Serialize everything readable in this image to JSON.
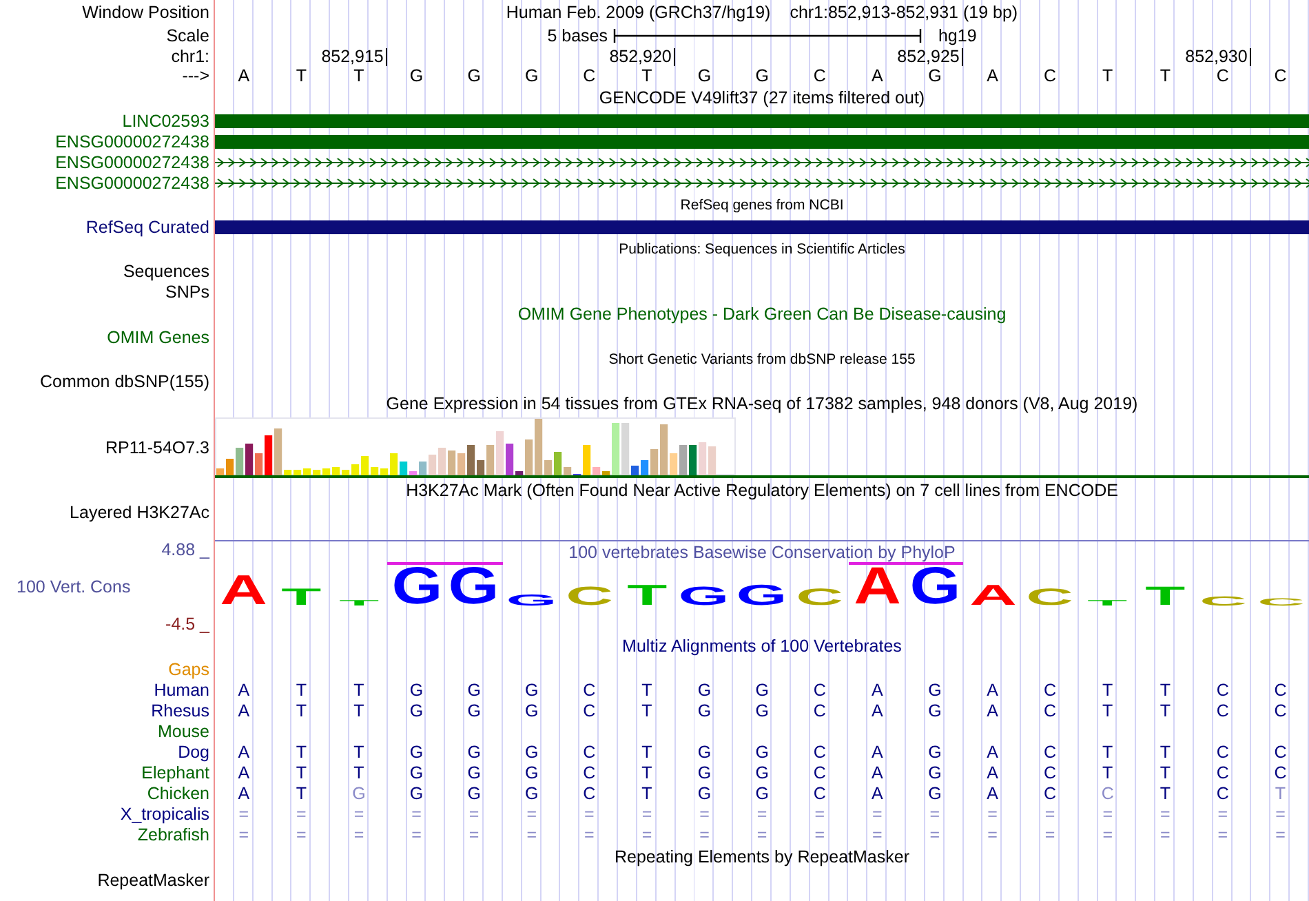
{
  "rows": [
    {
      "kind": "position",
      "label": "Window Position",
      "assembly": "Human Feb. 2009 (GRCh37/hg19)",
      "range": "chr1:852,913-852,931 (19 bp)"
    },
    {
      "kind": "scale",
      "label": "Scale",
      "span": "5 bases",
      "assembly": "hg19"
    },
    {
      "kind": "ruler",
      "label": "chr1:",
      "ticks": [
        "852,915",
        "852,920",
        "852,925",
        "852,930"
      ]
    },
    {
      "kind": "bases",
      "label": "--->",
      "bases": [
        "A",
        "T",
        "T",
        "G",
        "G",
        "G",
        "C",
        "T",
        "G",
        "G",
        "C",
        "A",
        "G",
        "A",
        "C",
        "T",
        "T",
        "C",
        "C"
      ]
    },
    {
      "kind": "title",
      "title": "GENCODE V49lift37 (27 items filtered out)"
    },
    {
      "kind": "bar",
      "label": "LINC02593",
      "color": "#006400"
    },
    {
      "kind": "bar",
      "label": "ENSG00000272438",
      "color": "#006400"
    },
    {
      "kind": "arrows",
      "label": "ENSG00000272438",
      "color": "#006400"
    },
    {
      "kind": "arrows",
      "label": "ENSG00000272438",
      "color": "#006400"
    },
    {
      "kind": "subtitle",
      "title": "RefSeq genes from NCBI"
    },
    {
      "kind": "bar",
      "label": "RefSeq Curated",
      "color": "#0c0c78"
    },
    {
      "kind": "subtitle",
      "title": "Publications: Sequences in Scientific Articles"
    },
    {
      "kind": "label",
      "label": "Sequences"
    },
    {
      "kind": "label",
      "label": "SNPs"
    },
    {
      "kind": "title",
      "title": "OMIM Gene Phenotypes - Dark Green Can Be Disease-causing",
      "color": "#006400"
    },
    {
      "kind": "label",
      "label": "OMIM Genes",
      "color": "#006400"
    },
    {
      "kind": "subtitle",
      "title": "Short Genetic Variants from dbSNP release 155"
    },
    {
      "kind": "label",
      "label": "Common dbSNP(155)"
    },
    {
      "kind": "title",
      "title": "Gene Expression in 54 tissues from GTEx RNA-seq of 17382 samples, 948 donors (V8, Aug 2019)"
    },
    {
      "kind": "expression",
      "label": "RP11-54O7.3"
    },
    {
      "kind": "title",
      "title": "H3K27Ac Mark (Often Found Near Active Regulatory Elements) on 7 cell lines from ENCODE"
    },
    {
      "kind": "layered",
      "label": "Layered H3K27Ac"
    },
    {
      "kind": "conservation",
      "label": "100 Vert. Cons",
      "max": "4.88 _",
      "min": "-4.5 _",
      "title": "100 vertebrates Basewise Conservation by PhyloP",
      "letters": [
        {
          "text": "A",
          "color": "#ff0000",
          "marked": false
        },
        {
          "text": "T",
          "color": "#00c000",
          "marked": false
        },
        {
          "text": "T",
          "color": "#00c000",
          "marked": false
        },
        {
          "text": "G",
          "color": "#0000ff",
          "marked": true
        },
        {
          "text": "G",
          "color": "#0000ff",
          "marked": true
        },
        {
          "text": "G",
          "color": "#0000ff",
          "marked": false
        },
        {
          "text": "C",
          "color": "#b0a800",
          "marked": false
        },
        {
          "text": "T",
          "color": "#00c000",
          "marked": false
        },
        {
          "text": "G",
          "color": "#0000ff",
          "marked": false
        },
        {
          "text": "G",
          "color": "#0000ff",
          "marked": false
        },
        {
          "text": "C",
          "color": "#b0a800",
          "marked": false
        },
        {
          "text": "A",
          "color": "#ff0000",
          "marked": true
        },
        {
          "text": "G",
          "color": "#0000ff",
          "marked": true
        },
        {
          "text": "A",
          "color": "#ff0000",
          "marked": false
        },
        {
          "text": "C",
          "color": "#b0a800",
          "marked": false
        },
        {
          "text": "T",
          "color": "#00c000",
          "marked": false
        },
        {
          "text": "T",
          "color": "#00c000",
          "marked": false
        },
        {
          "text": "C",
          "color": "#b0a800",
          "marked": false
        },
        {
          "text": "C",
          "color": "#b0a800",
          "marked": false
        }
      ]
    },
    {
      "kind": "title",
      "title": "Multiz Alignments of 100 Vertebrates",
      "color": "#000080"
    },
    {
      "kind": "species",
      "label": "Gaps",
      "color": "#e08c00"
    },
    {
      "kind": "species",
      "label": "Human",
      "color": "#000080",
      "bases": [
        "A",
        "T",
        "T",
        "G",
        "G",
        "G",
        "C",
        "T",
        "G",
        "G",
        "C",
        "A",
        "G",
        "A",
        "C",
        "T",
        "T",
        "C",
        "C"
      ],
      "faded": [
        false,
        false,
        false,
        false,
        false,
        false,
        false,
        false,
        false,
        false,
        false,
        false,
        false,
        false,
        false,
        false,
        false,
        false,
        false
      ]
    },
    {
      "kind": "species",
      "label": "Rhesus",
      "color": "#000080",
      "bases": [
        "A",
        "T",
        "T",
        "G",
        "G",
        "G",
        "C",
        "T",
        "G",
        "G",
        "C",
        "A",
        "G",
        "A",
        "C",
        "T",
        "T",
        "C",
        "C"
      ],
      "faded": [
        false,
        false,
        false,
        false,
        false,
        false,
        false,
        false,
        false,
        false,
        false,
        false,
        false,
        false,
        false,
        false,
        false,
        false,
        false
      ]
    },
    {
      "kind": "species",
      "label": "Mouse",
      "color": "#006400"
    },
    {
      "kind": "species",
      "label": "Dog",
      "color": "#000080",
      "bases": [
        "A",
        "T",
        "T",
        "G",
        "G",
        "G",
        "C",
        "T",
        "G",
        "G",
        "C",
        "A",
        "G",
        "A",
        "C",
        "T",
        "T",
        "C",
        "C"
      ],
      "faded": [
        false,
        false,
        false,
        false,
        false,
        false,
        false,
        false,
        false,
        false,
        false,
        false,
        false,
        false,
        false,
        false,
        false,
        false,
        false
      ]
    },
    {
      "kind": "species",
      "label": "Elephant",
      "color": "#006400",
      "bases": [
        "A",
        "T",
        "T",
        "G",
        "G",
        "G",
        "C",
        "T",
        "G",
        "G",
        "C",
        "A",
        "G",
        "A",
        "C",
        "T",
        "T",
        "C",
        "C"
      ],
      "faded": [
        false,
        false,
        false,
        false,
        false,
        false,
        false,
        false,
        false,
        false,
        false,
        false,
        false,
        false,
        false,
        false,
        false,
        false,
        false
      ]
    },
    {
      "kind": "species",
      "label": "Chicken",
      "color": "#006400",
      "bases": [
        "A",
        "T",
        "G",
        "G",
        "G",
        "G",
        "C",
        "T",
        "G",
        "G",
        "C",
        "A",
        "G",
        "A",
        "C",
        "C",
        "T",
        "C",
        "T"
      ],
      "faded": [
        false,
        false,
        true,
        false,
        false,
        false,
        false,
        false,
        false,
        false,
        false,
        false,
        false,
        false,
        false,
        true,
        false,
        false,
        true
      ]
    },
    {
      "kind": "species",
      "label": "X_tropicalis",
      "color": "#000080",
      "bases": [
        "=",
        "=",
        "=",
        "=",
        "=",
        "=",
        "=",
        "=",
        "=",
        "=",
        "=",
        "=",
        "=",
        "=",
        "=",
        "=",
        "=",
        "=",
        "="
      ],
      "faded": [
        true,
        true,
        true,
        true,
        true,
        true,
        true,
        true,
        true,
        true,
        true,
        true,
        true,
        true,
        true,
        true,
        true,
        true,
        true
      ]
    },
    {
      "kind": "species",
      "label": "Zebrafish",
      "color": "#006400",
      "bases": [
        "=",
        "=",
        "=",
        "=",
        "=",
        "=",
        "=",
        "=",
        "=",
        "=",
        "=",
        "=",
        "=",
        "=",
        "=",
        "=",
        "=",
        "=",
        "="
      ],
      "faded": [
        true,
        true,
        true,
        true,
        true,
        true,
        true,
        true,
        true,
        true,
        true,
        true,
        true,
        true,
        true,
        true,
        true,
        true,
        true
      ]
    },
    {
      "kind": "title",
      "title": "Repeating Elements by RepeatMasker"
    },
    {
      "kind": "label",
      "label": "RepeatMasker"
    }
  ]
}
